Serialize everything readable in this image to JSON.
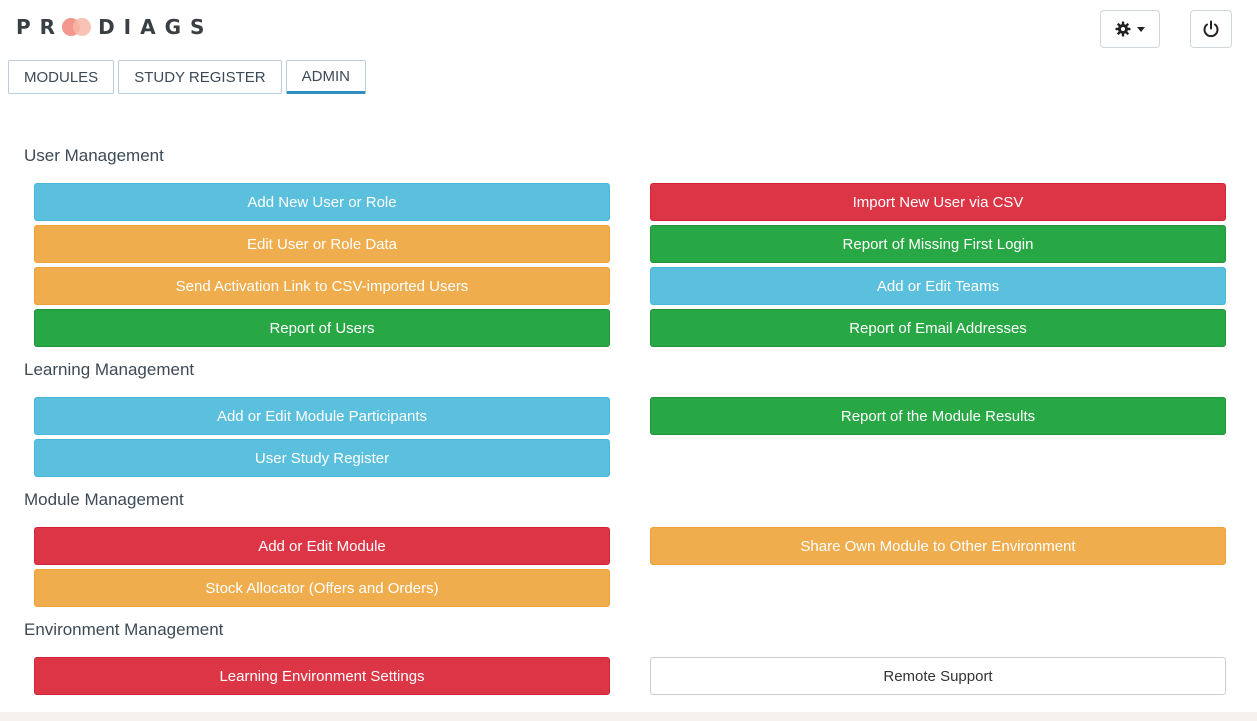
{
  "brand": {
    "part1": "PR",
    "part2": "DIAGS"
  },
  "header": {
    "settings_icon": "gear-icon",
    "settings_caret": "caret-down-icon",
    "power_icon": "power-icon"
  },
  "tabs": [
    {
      "label": "MODULES"
    },
    {
      "label": "STUDY REGISTER"
    },
    {
      "label": "ADMIN",
      "active": true
    }
  ],
  "sections": {
    "user": {
      "title": "User Management",
      "buttons": [
        {
          "label": "Add New User or Role",
          "color": "#5bc0de"
        },
        {
          "label": "Import New User via CSV",
          "color": "#dc3545"
        },
        {
          "label": "Edit User or Role Data",
          "color": "#f0ad4e"
        },
        {
          "label": "Report of Missing First Login",
          "color": "#28a745"
        },
        {
          "label": "Send Activation Link to CSV-imported Users",
          "color": "#f0ad4e"
        },
        {
          "label": "Add or Edit Teams",
          "color": "#5bc0de"
        },
        {
          "label": "Report of Users",
          "color": "#28a745"
        },
        {
          "label": "Report of Email Addresses",
          "color": "#28a745"
        }
      ]
    },
    "learning": {
      "title": "Learning Management",
      "buttons": [
        {
          "label": "Add or Edit Module Participants",
          "color": "#5bc0de"
        },
        {
          "label": "Report of the Module Results",
          "color": "#28a745"
        },
        {
          "label": "User Study Register",
          "color": "#5bc0de"
        }
      ]
    },
    "module": {
      "title": "Module Management",
      "buttons": [
        {
          "label": "Add or Edit Module",
          "color": "#dc3545"
        },
        {
          "label": "Share Own Module to Other Environment",
          "color": "#f0ad4e"
        },
        {
          "label": "Stock Allocator (Offers and Orders)",
          "color": "#f0ad4e"
        }
      ]
    },
    "environment": {
      "title": "Environment Management",
      "buttons": [
        {
          "label": "Learning Environment Settings",
          "color": "#dc3545"
        },
        {
          "label": "Remote Support",
          "color": "#ffffff"
        }
      ]
    }
  }
}
